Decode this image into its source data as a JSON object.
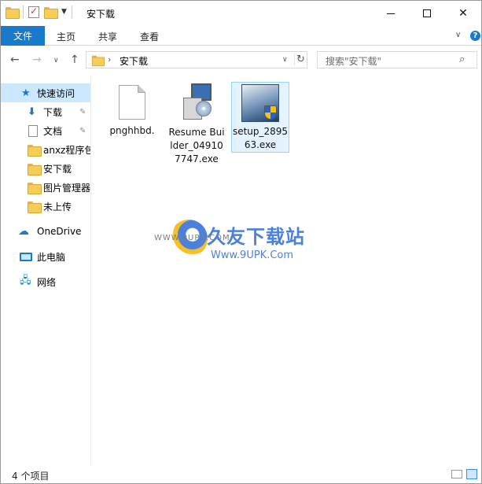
{
  "window": {
    "title": "安下载",
    "controls": {
      "minimize": "",
      "maximize": "",
      "close": "✕"
    }
  },
  "ribbon": {
    "file_tab": "文件",
    "tabs": [
      "主页",
      "共享",
      "查看"
    ],
    "help": "?"
  },
  "navigation": {
    "back": "←",
    "forward": "→",
    "recent": "∨",
    "up": "↑"
  },
  "address": {
    "separator": "›",
    "path": "安下载",
    "refresh": "↻",
    "dropdown": "∨"
  },
  "search": {
    "placeholder": "搜索\"安下载\"",
    "icon": "search-icon"
  },
  "sidebar": {
    "items": [
      {
        "label": "快速访问",
        "icon": "star-icon",
        "selected": true
      },
      {
        "label": "下载",
        "icon": "download-arrow-icon",
        "pinned": true
      },
      {
        "label": "文档",
        "icon": "document-icon",
        "pinned": true
      },
      {
        "label": "anxz程序包",
        "icon": "folder-icon"
      },
      {
        "label": "安下载",
        "icon": "folder-icon"
      },
      {
        "label": "图片管理器",
        "icon": "folder-icon"
      },
      {
        "label": "未上传",
        "icon": "folder-icon"
      },
      {
        "label": "OneDrive",
        "icon": "cloud-icon"
      },
      {
        "label": "此电脑",
        "icon": "computer-icon"
      },
      {
        "label": "网络",
        "icon": "network-icon"
      }
    ],
    "pin_glyph": "📌"
  },
  "files": [
    {
      "name": "pnghhbd.",
      "icon": "blank-file-icon",
      "selected": false
    },
    {
      "name": "Resume Builder_049107747.exe",
      "icon": "installer-icon",
      "selected": false
    },
    {
      "name": "setup_289563.exe",
      "icon": "setup-shield-icon",
      "selected": true
    }
  ],
  "watermark": {
    "title": "久友下载站",
    "url": "Www.9UPK.Com",
    "small": "WWW.9UPK.COM"
  },
  "status": {
    "item_count": "4 个项目"
  },
  "colors": {
    "accent": "#1979ca",
    "selection": "#cce8ff",
    "folder": "#f6cd5b"
  }
}
